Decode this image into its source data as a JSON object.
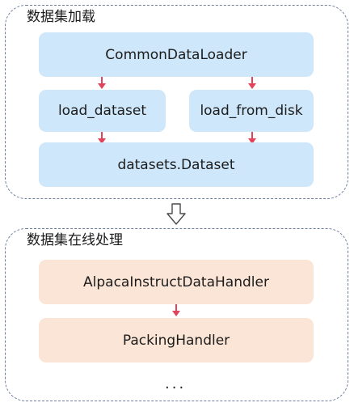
{
  "colors": {
    "group_border": "#6f7fa0",
    "node_blue": "#cfe7fa",
    "node_peach": "#fbe5d6",
    "arrow": "#e0435a"
  },
  "groups": [
    {
      "title": "数据集加载",
      "nodes": {
        "common_loader": "CommonDataLoader",
        "load_dataset": "load_dataset",
        "load_from_disk": "load_from_disk",
        "dataset": "datasets.Dataset"
      }
    },
    {
      "title": "数据集在线处理",
      "nodes": {
        "alpaca_handler": "AlpacaInstructDataHandler",
        "packing_handler": "PackingHandler"
      },
      "ellipsis": "..."
    }
  ],
  "connector_icon": "hollow-down-arrow-icon"
}
